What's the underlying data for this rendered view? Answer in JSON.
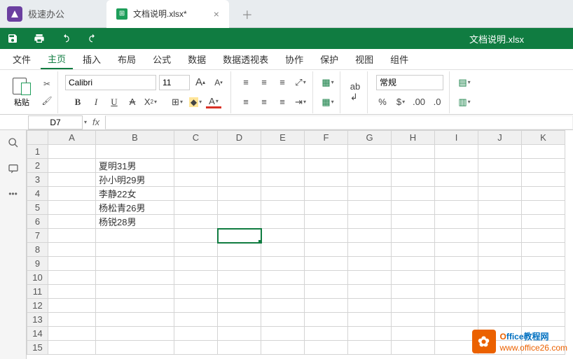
{
  "app": {
    "name": "极速办公"
  },
  "tab": {
    "title": "文档说明.xlsx*"
  },
  "doc_name": "文档说明.xlsx",
  "menus": [
    "文件",
    "主页",
    "插入",
    "布局",
    "公式",
    "数据",
    "数据透视表",
    "协作",
    "保护",
    "视图",
    "组件"
  ],
  "active_menu": 1,
  "ribbon": {
    "paste_label": "粘贴",
    "font_name": "Calibri",
    "font_size": "11",
    "number_format": "常规",
    "bold": "B",
    "italic": "I",
    "underline": "U",
    "strike": "A",
    "sub": "X₂",
    "bigA": "A",
    "smallA": "A"
  },
  "cellref": {
    "active": "D7"
  },
  "columns": [
    "A",
    "B",
    "C",
    "D",
    "E",
    "F",
    "G",
    "H",
    "I",
    "J",
    "K"
  ],
  "rows": 15,
  "data": {
    "B2": "夏明31男",
    "B3": "孙小明29男",
    "B4": "李静22女",
    "B5": "杨松青26男",
    "B6": "杨锐28男"
  },
  "selected": "D7",
  "watermark": {
    "brand_o": "O",
    "brand_rest": "ffice",
    "brand_cn": "教程网",
    "url": "www.office26.com"
  }
}
